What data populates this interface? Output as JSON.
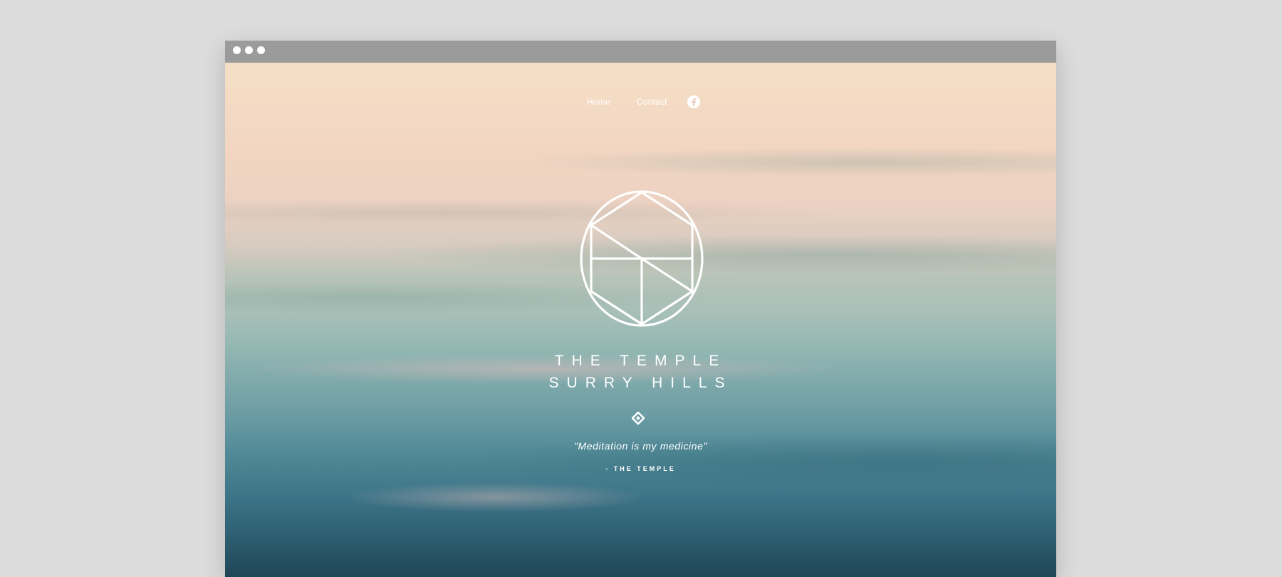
{
  "window": {
    "titlebar_color": "#9b9b9b"
  },
  "nav": {
    "home_label": "Home",
    "contact_label": "Contact",
    "social_icon": "facebook-icon"
  },
  "hero": {
    "logo_icon": "hexagon-circle-logo",
    "title_line1": "THE TEMPLE",
    "title_line2": "SURRY HILLS",
    "divider_icon": "diamond-icon",
    "quote": "\"Meditation is my medicine\"",
    "attribution": "- THE TEMPLE"
  },
  "colors": {
    "text": "#ffffff",
    "sky_top": "#f5dfc6",
    "water_bottom": "#1f4657"
  }
}
